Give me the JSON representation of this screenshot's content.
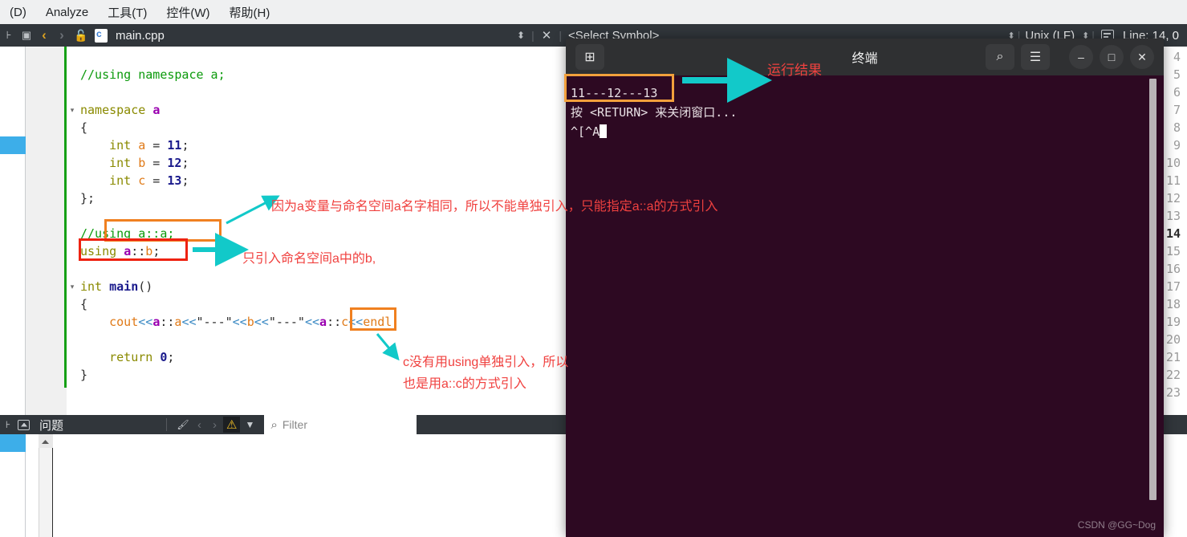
{
  "menubar": {
    "items": [
      {
        "label": "(D)"
      },
      {
        "label": "Analyze"
      },
      {
        "label": "工具(T)"
      },
      {
        "label": "控件(W)"
      },
      {
        "label": "帮助(H)"
      }
    ]
  },
  "tabbar": {
    "filename": "main.cpp",
    "symbol_selector": "<Select Symbol>",
    "close_label": "✕",
    "spin_label": "⬍",
    "line_ending": "Unix (LF)",
    "line_status": "Line: 14, 0"
  },
  "editor": {
    "lines": [
      {
        "num": "4",
        "fold": "",
        "current": false,
        "tokens": []
      },
      {
        "num": "5",
        "fold": "",
        "current": false,
        "tokens": [
          {
            "t": "//using namespace a;",
            "c": "c-com"
          }
        ]
      },
      {
        "num": "6",
        "fold": "",
        "current": false,
        "tokens": []
      },
      {
        "num": "7",
        "fold": "▾",
        "current": false,
        "tokens": [
          {
            "t": "namespace ",
            "c": "c-kw"
          },
          {
            "t": "a",
            "c": "c-ns"
          }
        ]
      },
      {
        "num": "8",
        "fold": "",
        "current": false,
        "tokens": [
          {
            "t": "{",
            "c": "c-pun"
          }
        ]
      },
      {
        "num": "9",
        "fold": "",
        "current": false,
        "tokens": [
          {
            "t": "    ",
            "c": "c-pun"
          },
          {
            "t": "int",
            "c": "c-kw"
          },
          {
            "t": " ",
            "c": "c-pun"
          },
          {
            "t": "a",
            "c": "c-var"
          },
          {
            "t": " = ",
            "c": "c-pun"
          },
          {
            "t": "11",
            "c": "c-num"
          },
          {
            "t": ";",
            "c": "c-pun"
          }
        ]
      },
      {
        "num": "10",
        "fold": "",
        "current": false,
        "tokens": [
          {
            "t": "    ",
            "c": "c-pun"
          },
          {
            "t": "int",
            "c": "c-kw"
          },
          {
            "t": " ",
            "c": "c-pun"
          },
          {
            "t": "b",
            "c": "c-var"
          },
          {
            "t": " = ",
            "c": "c-pun"
          },
          {
            "t": "12",
            "c": "c-num"
          },
          {
            "t": ";",
            "c": "c-pun"
          }
        ]
      },
      {
        "num": "11",
        "fold": "",
        "current": false,
        "tokens": [
          {
            "t": "    ",
            "c": "c-pun"
          },
          {
            "t": "int",
            "c": "c-kw"
          },
          {
            "t": " ",
            "c": "c-pun"
          },
          {
            "t": "c",
            "c": "c-var"
          },
          {
            "t": " = ",
            "c": "c-pun"
          },
          {
            "t": "13",
            "c": "c-num"
          },
          {
            "t": ";",
            "c": "c-pun"
          }
        ]
      },
      {
        "num": "12",
        "fold": "",
        "current": false,
        "tokens": [
          {
            "t": "};",
            "c": "c-pun"
          }
        ]
      },
      {
        "num": "13",
        "fold": "",
        "current": false,
        "tokens": []
      },
      {
        "num": "14",
        "fold": "",
        "current": true,
        "tokens": [
          {
            "t": "//using a::a;",
            "c": "c-com"
          }
        ]
      },
      {
        "num": "15",
        "fold": "",
        "current": false,
        "tokens": [
          {
            "t": "using ",
            "c": "c-kw"
          },
          {
            "t": "a",
            "c": "c-ns"
          },
          {
            "t": "::",
            "c": "c-pun"
          },
          {
            "t": "b",
            "c": "c-var"
          },
          {
            "t": ";",
            "c": "c-pun"
          }
        ]
      },
      {
        "num": "16",
        "fold": "",
        "current": false,
        "tokens": []
      },
      {
        "num": "17",
        "fold": "▾",
        "current": false,
        "tokens": [
          {
            "t": "int ",
            "c": "c-kw"
          },
          {
            "t": "main",
            "c": "c-fn"
          },
          {
            "t": "()",
            "c": "c-pun"
          }
        ]
      },
      {
        "num": "18",
        "fold": "",
        "current": false,
        "tokens": [
          {
            "t": "{",
            "c": "c-pun"
          }
        ]
      },
      {
        "num": "19",
        "fold": "",
        "current": false,
        "tokens": [
          {
            "t": "    ",
            "c": "c-pun"
          },
          {
            "t": "cout",
            "c": "c-obj"
          },
          {
            "t": "<<",
            "c": "c-op"
          },
          {
            "t": "a",
            "c": "c-ns"
          },
          {
            "t": "::",
            "c": "c-pun"
          },
          {
            "t": "a",
            "c": "c-var"
          },
          {
            "t": "<<",
            "c": "c-op"
          },
          {
            "t": "\"---\"",
            "c": "c-pun"
          },
          {
            "t": "<<",
            "c": "c-op"
          },
          {
            "t": "b",
            "c": "c-var"
          },
          {
            "t": "<<",
            "c": "c-op"
          },
          {
            "t": "\"---\"",
            "c": "c-pun"
          },
          {
            "t": "<<",
            "c": "c-op"
          },
          {
            "t": "a",
            "c": "c-ns"
          },
          {
            "t": "::",
            "c": "c-pun"
          },
          {
            "t": "c",
            "c": "c-var"
          },
          {
            "t": "<<",
            "c": "c-op"
          },
          {
            "t": "endl",
            "c": "c-obj"
          },
          {
            "t": ";",
            "c": "c-pun"
          }
        ]
      },
      {
        "num": "20",
        "fold": "",
        "current": false,
        "tokens": []
      },
      {
        "num": "21",
        "fold": "",
        "current": false,
        "tokens": [
          {
            "t": "    ",
            "c": "c-pun"
          },
          {
            "t": "return",
            "c": "c-kw"
          },
          {
            "t": " ",
            "c": "c-pun"
          },
          {
            "t": "0",
            "c": "c-num"
          },
          {
            "t": ";",
            "c": "c-pun"
          }
        ]
      },
      {
        "num": "22",
        "fold": "",
        "current": false,
        "tokens": [
          {
            "t": "}",
            "c": "c-pun"
          }
        ]
      },
      {
        "num": "23",
        "fold": "",
        "current": false,
        "tokens": []
      }
    ]
  },
  "annotations": {
    "note_line14": "因为a变量与命名空间a名字相同，所以不能单独引入，只能指定a::a的方式引入",
    "note_line15": "只引入命名空间a中的b,",
    "note_line19_l1": "c没有用using单独引入，所以",
    "note_line19_l2": "也是用a::c的方式引入",
    "note_terminal": "运行结果"
  },
  "problems_panel": {
    "title": "问题",
    "filter_placeholder": "Filter",
    "warn_icon": "⚠",
    "clear_icon": "🖌",
    "prev_icon": "‹",
    "next_icon": "›",
    "funnel_icon": "▼",
    "search_icon": "⌕"
  },
  "terminal": {
    "title": "终端",
    "new_tab_icon": "⊞",
    "search_icon": "⌕",
    "menu_icon": "☰",
    "minimize_icon": "–",
    "maximize_icon": "□",
    "close_icon": "✕",
    "output_lines": [
      "11---12---13",
      "按 <RETURN> 来关闭窗口...",
      "^[^A"
    ],
    "watermark": "CSDN @GG~Dog"
  },
  "colors": {
    "accent_blue": "#3daee9",
    "annotation_red": "#f0413f",
    "arrow_cyan": "#12c9c9",
    "box_orange": "#f08020",
    "box_red": "#ee2211",
    "terminal_bg": "#2d0922",
    "chrome_dark": "#31363b"
  }
}
